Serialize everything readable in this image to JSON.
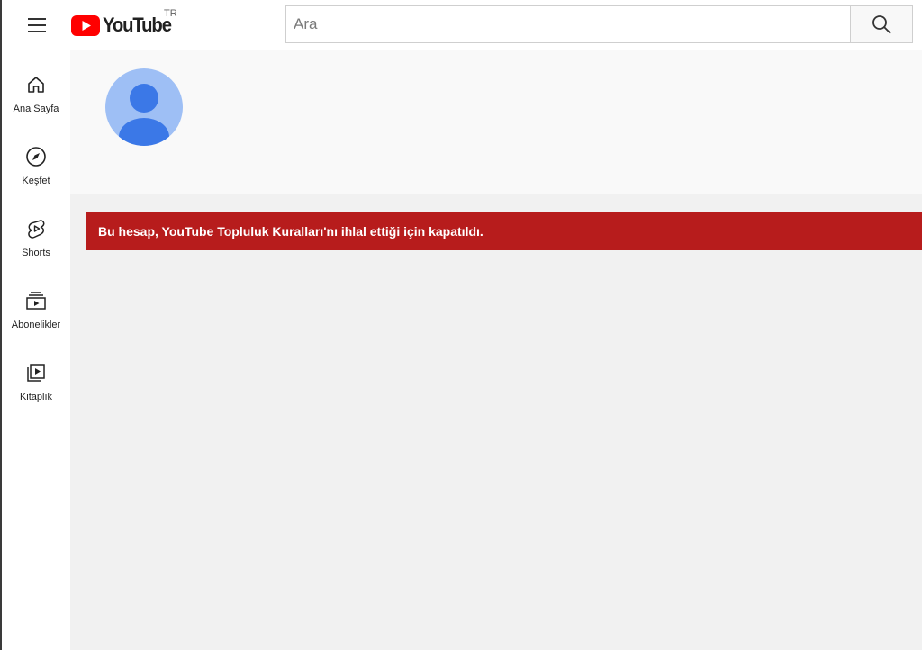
{
  "header": {
    "logo_text": "YouTube",
    "region_code": "TR",
    "search_placeholder": "Ara",
    "brand_color": "#FF0000"
  },
  "sidebar": {
    "items": [
      {
        "label": "Ana Sayfa",
        "icon": "home-icon"
      },
      {
        "label": "Keşfet",
        "icon": "compass-icon"
      },
      {
        "label": "Shorts",
        "icon": "shorts-icon"
      },
      {
        "label": "Abonelikler",
        "icon": "subscriptions-icon"
      },
      {
        "label": "Kitaplık",
        "icon": "library-icon"
      }
    ]
  },
  "channel": {
    "avatar": "default-avatar-icon",
    "notice": "Bu hesap, YouTube Topluluk Kuralları'nı ihlal ettiği için kapatıldı.",
    "notice_color": "#B71C1C"
  }
}
